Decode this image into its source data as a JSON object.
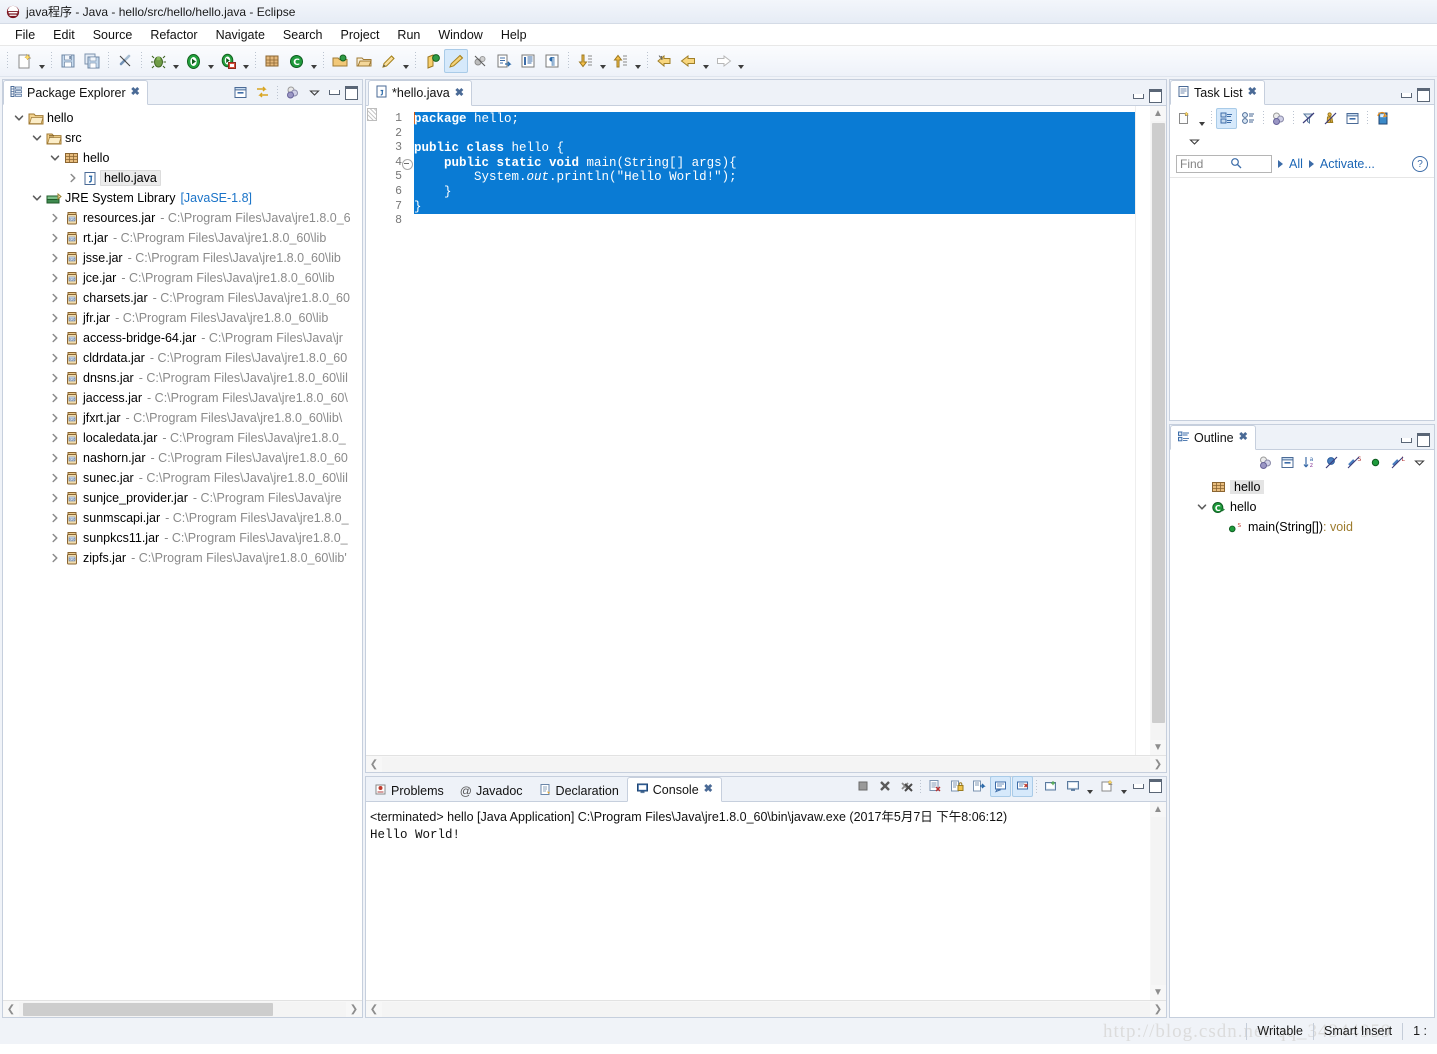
{
  "window": {
    "title": "java程序 - Java - hello/src/hello/hello.java - Eclipse",
    "app_icon": "eclipse-icon"
  },
  "menubar": {
    "items": [
      {
        "label": "File",
        "name": "menu-file"
      },
      {
        "label": "Edit",
        "name": "menu-edit"
      },
      {
        "label": "Source",
        "name": "menu-source"
      },
      {
        "label": "Refactor",
        "name": "menu-refactor"
      },
      {
        "label": "Navigate",
        "name": "menu-navigate"
      },
      {
        "label": "Search",
        "name": "menu-search"
      },
      {
        "label": "Project",
        "name": "menu-project"
      },
      {
        "label": "Run",
        "name": "menu-run"
      },
      {
        "label": "Window",
        "name": "menu-window"
      },
      {
        "label": "Help",
        "name": "menu-help"
      }
    ]
  },
  "toolbar": {
    "groups": [
      [
        "new-wizard-icon",
        "dropdown-arrow"
      ],
      [
        "save-icon",
        "save-all-icon"
      ],
      [
        "link-break-icon"
      ],
      [
        "debug-icon",
        "dropdown-arrow",
        "run-icon",
        "dropdown-arrow",
        "run-external-icon",
        "dropdown-arrow"
      ],
      [
        "new-java-package-icon",
        "new-java-class-icon",
        "dropdown-arrow"
      ],
      [
        "open-type-icon",
        "open-task-icon",
        "search-marker-icon",
        "dropdown-arrow"
      ],
      [
        "annotation-icon",
        "toggle-mark-occurrences-icon",
        "skip-all-breakpoints-icon",
        "next-annotation-icon",
        "show-whitespace-icon",
        "pilcrow-icon"
      ],
      [
        "next-edit-icon",
        "dropdown-arrow",
        "previous-edit-icon",
        "dropdown-arrow"
      ],
      [
        "back-history-icon",
        "back-icon",
        "dropdown-arrow",
        "forward-icon",
        "dropdown-arrow"
      ]
    ]
  },
  "package_explorer": {
    "title": "Package Explorer",
    "tab_icon": "package-explorer-icon",
    "tools": [
      "collapse-all-icon",
      "link-with-editor-icon",
      "view-filter-icon",
      "view-menu-icon"
    ],
    "tree": [
      {
        "indent": 0,
        "twisty": "down",
        "icon": "project-folder-icon",
        "label": "hello",
        "path": "",
        "selected": false
      },
      {
        "indent": 1,
        "twisty": "down",
        "icon": "source-folder-icon",
        "label": "src",
        "path": "",
        "selected": false
      },
      {
        "indent": 2,
        "twisty": "down",
        "icon": "package-icon",
        "label": "hello",
        "path": "",
        "selected": false
      },
      {
        "indent": 3,
        "twisty": "right",
        "icon": "java-file-icon",
        "label": "hello.java",
        "path": "",
        "selected": true
      },
      {
        "indent": 1,
        "twisty": "down",
        "icon": "jre-library-icon",
        "label": "JRE System Library",
        "version": "[JavaSE-1.8]",
        "path": "",
        "selected": false
      },
      {
        "indent": 2,
        "twisty": "right",
        "icon": "jar-icon",
        "label": "resources.jar",
        "path": "- C:\\Program Files\\Java\\jre1.8.0_6"
      },
      {
        "indent": 2,
        "twisty": "right",
        "icon": "jar-icon",
        "label": "rt.jar",
        "path": "- C:\\Program Files\\Java\\jre1.8.0_60\\lib"
      },
      {
        "indent": 2,
        "twisty": "right",
        "icon": "jar-icon",
        "label": "jsse.jar",
        "path": "- C:\\Program Files\\Java\\jre1.8.0_60\\lib"
      },
      {
        "indent": 2,
        "twisty": "right",
        "icon": "jar-icon",
        "label": "jce.jar",
        "path": "- C:\\Program Files\\Java\\jre1.8.0_60\\lib"
      },
      {
        "indent": 2,
        "twisty": "right",
        "icon": "jar-icon",
        "label": "charsets.jar",
        "path": "- C:\\Program Files\\Java\\jre1.8.0_60"
      },
      {
        "indent": 2,
        "twisty": "right",
        "icon": "jar-icon",
        "label": "jfr.jar",
        "path": "- C:\\Program Files\\Java\\jre1.8.0_60\\lib"
      },
      {
        "indent": 2,
        "twisty": "right",
        "icon": "jar-icon",
        "label": "access-bridge-64.jar",
        "path": "- C:\\Program Files\\Java\\jr"
      },
      {
        "indent": 2,
        "twisty": "right",
        "icon": "jar-icon",
        "label": "cldrdata.jar",
        "path": "- C:\\Program Files\\Java\\jre1.8.0_60"
      },
      {
        "indent": 2,
        "twisty": "right",
        "icon": "jar-icon",
        "label": "dnsns.jar",
        "path": "- C:\\Program Files\\Java\\jre1.8.0_60\\lil"
      },
      {
        "indent": 2,
        "twisty": "right",
        "icon": "jar-icon",
        "label": "jaccess.jar",
        "path": "- C:\\Program Files\\Java\\jre1.8.0_60\\"
      },
      {
        "indent": 2,
        "twisty": "right",
        "icon": "jar-icon",
        "label": "jfxrt.jar",
        "path": "- C:\\Program Files\\Java\\jre1.8.0_60\\lib\\"
      },
      {
        "indent": 2,
        "twisty": "right",
        "icon": "jar-icon",
        "label": "localedata.jar",
        "path": "- C:\\Program Files\\Java\\jre1.8.0_"
      },
      {
        "indent": 2,
        "twisty": "right",
        "icon": "jar-icon",
        "label": "nashorn.jar",
        "path": "- C:\\Program Files\\Java\\jre1.8.0_60"
      },
      {
        "indent": 2,
        "twisty": "right",
        "icon": "jar-icon",
        "label": "sunec.jar",
        "path": "- C:\\Program Files\\Java\\jre1.8.0_60\\lil"
      },
      {
        "indent": 2,
        "twisty": "right",
        "icon": "jar-icon",
        "label": "sunjce_provider.jar",
        "path": "- C:\\Program Files\\Java\\jre"
      },
      {
        "indent": 2,
        "twisty": "right",
        "icon": "jar-icon",
        "label": "sunmscapi.jar",
        "path": "- C:\\Program Files\\Java\\jre1.8.0_"
      },
      {
        "indent": 2,
        "twisty": "right",
        "icon": "jar-icon",
        "label": "sunpkcs11.jar",
        "path": "- C:\\Program Files\\Java\\jre1.8.0_"
      },
      {
        "indent": 2,
        "twisty": "right",
        "icon": "jar-icon",
        "label": "zipfs.jar",
        "path": "- C:\\Program Files\\Java\\jre1.8.0_60\\lib'"
      }
    ]
  },
  "editor": {
    "tab": {
      "label": "*hello.java",
      "icon": "java-file-icon",
      "dirty": true
    },
    "lines": [
      {
        "no": "1",
        "fold": false,
        "selected": true,
        "tokens": [
          {
            "t": "caret",
            "v": ""
          },
          {
            "t": "kw",
            "v": "package"
          },
          {
            "t": "p",
            "v": " hello;"
          }
        ]
      },
      {
        "no": "2",
        "fold": false,
        "selected": true,
        "tokens": [
          {
            "t": "p",
            "v": ""
          }
        ]
      },
      {
        "no": "3",
        "fold": false,
        "selected": true,
        "tokens": [
          {
            "t": "kw",
            "v": "public class"
          },
          {
            "t": "p",
            "v": " hello {"
          }
        ]
      },
      {
        "no": "4",
        "fold": true,
        "selected": true,
        "tokens": [
          {
            "t": "p",
            "v": "    "
          },
          {
            "t": "kw",
            "v": "public static void"
          },
          {
            "t": "p",
            "v": " main(String[] args){"
          }
        ]
      },
      {
        "no": "5",
        "fold": false,
        "selected": true,
        "tokens": [
          {
            "t": "p",
            "v": "        System."
          },
          {
            "t": "it",
            "v": "out"
          },
          {
            "t": "p",
            "v": ".println("
          },
          {
            "t": "st",
            "v": "\"Hello World!\""
          },
          {
            "t": "p",
            "v": ");"
          }
        ]
      },
      {
        "no": "6",
        "fold": false,
        "selected": true,
        "tokens": [
          {
            "t": "p",
            "v": "    }"
          }
        ]
      },
      {
        "no": "7",
        "fold": false,
        "selected": true,
        "tokens": [
          {
            "t": "p",
            "v": "}"
          }
        ]
      },
      {
        "no": "8",
        "fold": false,
        "selected": false,
        "tokens": [
          {
            "t": "p",
            "v": ""
          }
        ]
      }
    ]
  },
  "console_view": {
    "tabs": [
      {
        "label": "Problems",
        "icon": "problems-icon",
        "active": false
      },
      {
        "label": "Javadoc",
        "icon": "javadoc-icon",
        "active": false
      },
      {
        "label": "Declaration",
        "icon": "declaration-icon",
        "active": false
      },
      {
        "label": "Console",
        "icon": "console-icon",
        "active": true
      }
    ],
    "tools": [
      "terminate-icon",
      "remove-launch-icon",
      "remove-all-launches-icon",
      "clear-console-icon",
      "lock-scroll-icon",
      "pin-console-icon",
      "display-selected-console-icon",
      "open-console-icon",
      "new-console-view-icon",
      "console-dropdown-icon",
      "view-menu-icon"
    ],
    "header_line": "<terminated> hello [Java Application] C:\\Program Files\\Java\\jre1.8.0_60\\bin\\javaw.exe (2017年5月7日 下午8:06:12)",
    "output": "Hello World!"
  },
  "task_list": {
    "title": "Task List",
    "tab_icon": "task-list-icon",
    "tools": [
      "new-task-icon",
      "dropdown-arrow",
      "categorized-presentation-icon",
      "scheduled-presentation-icon",
      "focus-on-workweek-icon",
      "filter-completed-icon",
      "collapse-all-icon",
      "synchronize-changed-icon",
      "view-menu-icon"
    ],
    "find_placeholder": "Find",
    "search_icon": "search-icon",
    "scope_label": "All",
    "activate_label": "Activate...",
    "help_icon": "help-icon"
  },
  "outline": {
    "title": "Outline",
    "tab_icon": "outline-icon",
    "tools": [
      "focus-on-active-task-icon",
      "collapse-all-icon",
      "sort-icon",
      "hide-fields-icon",
      "hide-static-icon",
      "hide-nonpublic-icon",
      "hide-local-types-icon",
      "view-menu-icon"
    ],
    "tree": [
      {
        "indent": 1,
        "twisty": "none",
        "icon": "package-icon",
        "label": "hello",
        "selected": true
      },
      {
        "indent": 1,
        "twisty": "down",
        "icon": "class-icon",
        "label": "hello",
        "selected": false
      },
      {
        "indent": 2,
        "twisty": "none",
        "icon": "method-public-static-icon",
        "label": "main(String[])",
        "suffix": " : void",
        "selected": false
      }
    ]
  },
  "status_bar": {
    "watermark": "http://blog.csdn.net/qq_34344959",
    "writable": "Writable",
    "insert_mode": "Smart Insert",
    "position": "1 :"
  },
  "colors": {
    "selection_blue": "#0a7bd4",
    "title_text": "#1a1a1a",
    "link_blue": "#1b66b5",
    "path_gray": "#8a8a8a"
  }
}
